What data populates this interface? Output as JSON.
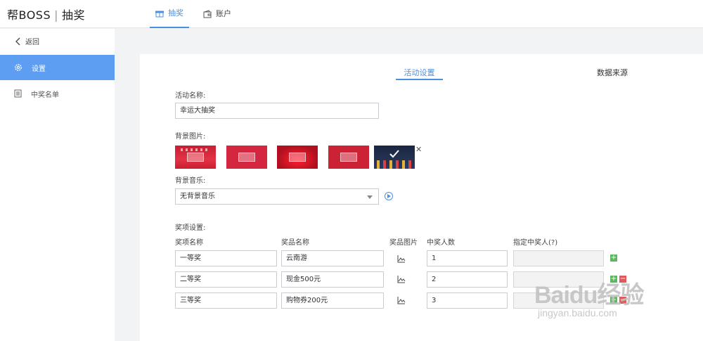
{
  "app": {
    "brand": "帮BOSS",
    "section": "抽奖"
  },
  "top_tabs": [
    {
      "label": "抽奖",
      "icon": "gift-icon",
      "active": true
    },
    {
      "label": "账户",
      "icon": "wallet-icon",
      "active": false
    }
  ],
  "sidebar": {
    "back_label": "返回",
    "items": [
      {
        "label": "设置",
        "icon": "gear-icon",
        "active": true
      },
      {
        "label": "中奖名单",
        "icon": "list-icon",
        "active": false
      }
    ]
  },
  "content_tabs": [
    {
      "label": "活动设置",
      "active": true
    },
    {
      "label": "数据来源",
      "active": false
    }
  ],
  "form": {
    "activity_name_label": "活动名称:",
    "activity_name_value": "幸运大抽奖",
    "background_image_label": "背景图片:",
    "background_music_label": "背景音乐:",
    "background_music_value": "无背景音乐",
    "prize_settings_label": "奖项设置:"
  },
  "prize_table": {
    "headers": [
      "奖项名称",
      "奖品名称",
      "奖品图片",
      "中奖人数",
      "指定中奖人(?)"
    ],
    "rows": [
      {
        "level": "一等奖",
        "prize": "云南游",
        "count": "1"
      },
      {
        "level": "二等奖",
        "prize": "现金500元",
        "count": "2"
      },
      {
        "level": "三等奖",
        "prize": "购物券200元",
        "count": "3"
      }
    ]
  },
  "colors": {
    "accent": "#4a90e2",
    "sidebar_active": "#5e9ef2",
    "add": "#5cb85c",
    "remove": "#e05a5a"
  },
  "watermark": {
    "logo": "Baidu经验",
    "url": "jingyan.baidu.com"
  }
}
